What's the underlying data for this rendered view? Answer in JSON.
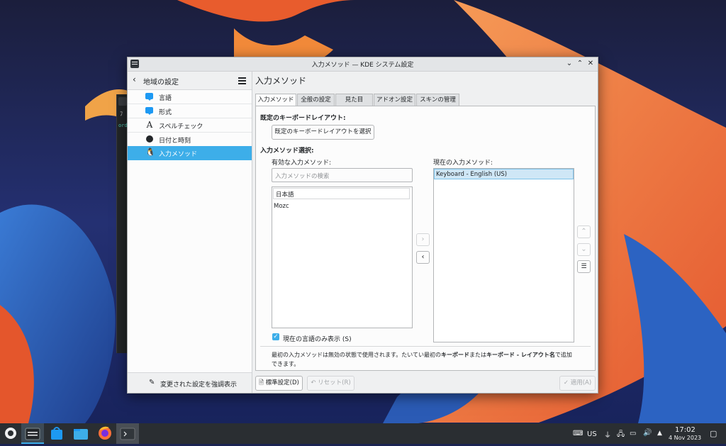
{
  "window": {
    "title": "入力メソッド — KDE システム設定",
    "controls": {
      "minimize": "⌄",
      "maximize": "⌃",
      "close": "✕"
    }
  },
  "sidebar": {
    "header_title": "地域の設定",
    "items": [
      {
        "label": "言語",
        "icon": "speech-bubble-icon"
      },
      {
        "label": "形式",
        "icon": "speech-bubble-icon"
      },
      {
        "label": "スペルチェック",
        "icon": "spellcheck-icon"
      },
      {
        "label": "日付と時刻",
        "icon": "clock-icon"
      },
      {
        "label": "入力メソッド",
        "icon": "penguin-icon",
        "selected": true
      }
    ],
    "footer_label": "変更された設定を強調表示"
  },
  "main": {
    "title": "入力メソッド",
    "tabs": [
      "入力メソッド",
      "全般の設定",
      "見た目",
      "アドオン設定",
      "スキンの管理"
    ],
    "default_layout_heading": "既定のキーボードレイアウト:",
    "default_layout_button": "既定のキーボードレイアウトを選択",
    "select_heading": "入力メソッド選択:",
    "available_label": "有効な入力メソッド:",
    "search_placeholder": "入力メソッドの検索",
    "available_items": [
      "日本語",
      "Mozc"
    ],
    "current_label": "現在の入力メソッド:",
    "current_items": [
      "Keyboard - English (US)"
    ],
    "only_current_language": "現在の言語のみ表示 (S)",
    "note_part1": "最初の入力メソッドは無効の状態で使用されます。たいてい最初の",
    "note_bold1": "キーボード",
    "note_part2": "または",
    "note_bold2": "キーボード - レイアウト名",
    "note_part3": "で追加",
    "note_line2": "できます。"
  },
  "footer": {
    "defaults": "標準設定(D)",
    "reset": "リセット(R)",
    "apply": "適用(A)"
  },
  "background_terminal": {
    "text": "ﾌ",
    "prompt": "ord"
  },
  "taskbar": {
    "keyboard_layout": "US",
    "time": "17:02",
    "date": "4 Nov 2023"
  },
  "colors": {
    "accent": "#3daee9",
    "window_bg": "#eff0f1",
    "taskbar_bg": "#2a2e32"
  }
}
